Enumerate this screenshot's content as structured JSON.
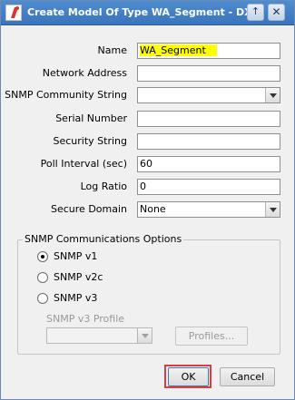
{
  "window": {
    "title": "Create Model Of Type WA_Segment - DX Net",
    "pin_icon": "↑",
    "close_icon": "✕"
  },
  "form": {
    "name": {
      "label": "Name",
      "value": "WA_Segment"
    },
    "network_address": {
      "label": "Network Address",
      "value": ""
    },
    "snmp_community": {
      "label": "SNMP Community String",
      "value": ""
    },
    "serial_number": {
      "label": "Serial Number",
      "value": ""
    },
    "security_string": {
      "label": "Security String",
      "value": ""
    },
    "poll_interval": {
      "label": "Poll Interval (sec)",
      "value": "60"
    },
    "log_ratio": {
      "label": "Log Ratio",
      "value": "0"
    },
    "secure_domain": {
      "label": "Secure Domain",
      "value": "None"
    }
  },
  "snmp_options": {
    "title": "SNMP Communications Options",
    "options": [
      {
        "label": "SNMP v1",
        "checked": true
      },
      {
        "label": "SNMP v2c",
        "checked": false
      },
      {
        "label": "SNMP v3",
        "checked": false
      }
    ],
    "v3_profile_label": "SNMP v3 Profile",
    "v3_profile_value": "",
    "profiles_button": "Profiles..."
  },
  "buttons": {
    "ok": "OK",
    "cancel": "Cancel"
  }
}
